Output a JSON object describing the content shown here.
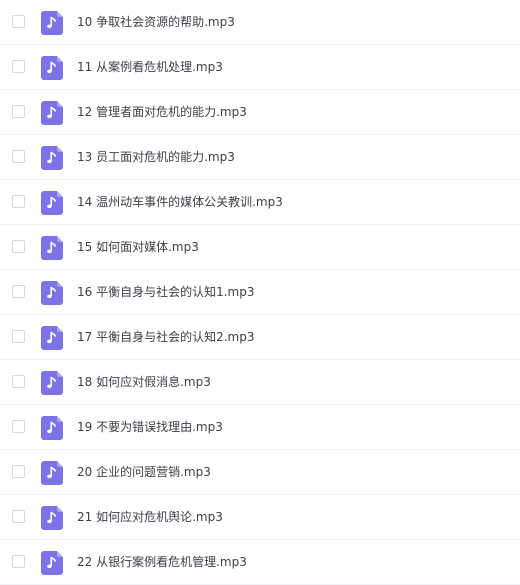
{
  "file_list": {
    "icon": "audio-file-icon",
    "icon_color": "#7b73e8",
    "items": [
      {
        "name": "10 争取社会资源的帮助.mp3"
      },
      {
        "name": "11 从案例看危机处理.mp3"
      },
      {
        "name": "12 管理者面对危机的能力.mp3"
      },
      {
        "name": "13 员工面对危机的能力.mp3"
      },
      {
        "name": "14 温州动车事件的媒体公关教训.mp3"
      },
      {
        "name": "15 如何面对媒体.mp3"
      },
      {
        "name": "16 平衡自身与社会的认知1.mp3"
      },
      {
        "name": "17 平衡自身与社会的认知2.mp3"
      },
      {
        "name": "18 如何应对假消息.mp3"
      },
      {
        "name": "19 不要为错误找理由.mp3"
      },
      {
        "name": "20 企业的问题营销.mp3"
      },
      {
        "name": "21 如何应对危机舆论.mp3"
      },
      {
        "name": "22 从银行案例看危机管理.mp3"
      }
    ]
  }
}
